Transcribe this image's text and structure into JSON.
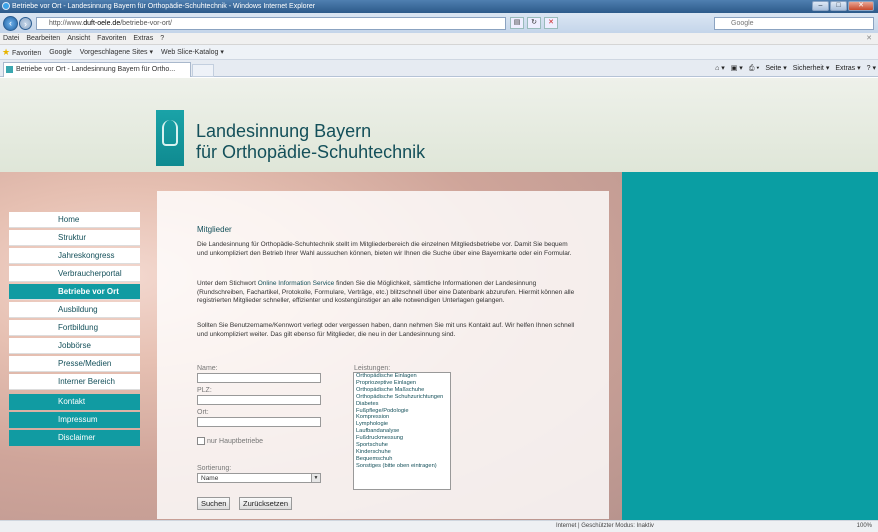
{
  "window": {
    "title": "Betriebe vor Ort - Landesinnung Bayern für Orthopädie-Schuhtechnik - Windows Internet Explorer"
  },
  "address": {
    "prefix": "http://www.",
    "host": "duft-oele.de",
    "path": "/betriebe-vor-ort/"
  },
  "search": {
    "placeholder": "Google"
  },
  "menu": [
    "Datei",
    "Bearbeiten",
    "Ansicht",
    "Favoriten",
    "Extras",
    "?"
  ],
  "favorites": {
    "label": "Favoriten",
    "items": [
      "Google",
      "Vorgeschlagene Sites ▾",
      "Web Slice-Katalog ▾"
    ]
  },
  "tab": {
    "label": "Betriebe vor Ort - Landesinnung Bayern für Ortho..."
  },
  "commandbar": [
    "Seite ▾",
    "Sicherheit ▾",
    "Extras ▾"
  ],
  "brand": {
    "line1": "Landesinnung Bayern",
    "line2": "für Orthopädie-Schuhtechnik"
  },
  "nav": {
    "items": [
      "Home",
      "Struktur",
      "Jahreskongress",
      "Verbraucherportal",
      "Betriebe vor Ort",
      "Ausbildung",
      "Fortbildung",
      "Jobbörse",
      "Presse/Medien",
      "Interner Bereich"
    ],
    "active": "Betriebe vor Ort",
    "secondary": [
      "Kontakt",
      "Impressum",
      "Disclaimer"
    ]
  },
  "content": {
    "title": "Mitglieder",
    "p1": "Die Landesinnung für Orthopädie-Schuhtechnik stellt im Mitgliederbereich die einzelnen Mitgliedsbetriebe vor. Damit Sie bequem und unkompliziert den Betrieb Ihrer Wahl aussuchen können, bieten wir Ihnen die Suche über eine Bayernkarte oder ein Formular.",
    "p2_before": "Unter dem Stichwort ",
    "p2_link": "Online Information Service",
    "p2_after": " finden Sie die Möglichkeit, sämtliche Informationen der Landesinnung (Rundschreiben, Fachartikel, Protokolle, Formulare, Verträge, etc.) blitzschnell über eine Datenbank abzurufen. Hiermit können alle registrierten Mitglieder schneller, effizienter und kostengünstiger an alle notwendigen Unterlagen gelangen.",
    "p3": "Sollten Sie Benutzername/Kennwort verlegt oder vergessen haben, dann nehmen Sie mit uns Kontakt auf. Wir helfen Ihnen schnell und unkompliziert weiter. Das gilt ebenso für Mitglieder, die neu in der Landesinnung sind."
  },
  "form": {
    "name_label": "Name:",
    "name_value": "",
    "plz_label": "PLZ:",
    "plz_value": "",
    "ort_label": "Ort:",
    "ort_value": "",
    "checkbox_label": "nur Hauptbetriebe",
    "checkbox_checked": false,
    "sort_label": "Sortierung:",
    "sort_value": "Name",
    "leistungen_label": "Leistungen:",
    "leistungen": [
      "Orthopädische Einlagen",
      "Propriozeptive Einlagen",
      "Orthopädische Maßschuhe",
      "Orthopädische Schuhzurichtungen",
      "Diabetes",
      "Fußpflege/Podologie",
      "Kompression",
      "Lymphologie",
      "Laufbandanalyse",
      "Fußdruckmessung",
      "Sportschuhe",
      "Kinderschuhe",
      "Bequemschuh",
      "Sonstiges (bitte oben eintragen)"
    ],
    "submit": "Suchen",
    "reset": "Zurücksetzen"
  },
  "status": {
    "zone": "Internet | Geschützter Modus: Inaktiv",
    "zoom": "100%"
  },
  "colors": {
    "teal": "#0a9ea3",
    "nav_active": "#119ba2",
    "brand_text": "#14505a"
  }
}
